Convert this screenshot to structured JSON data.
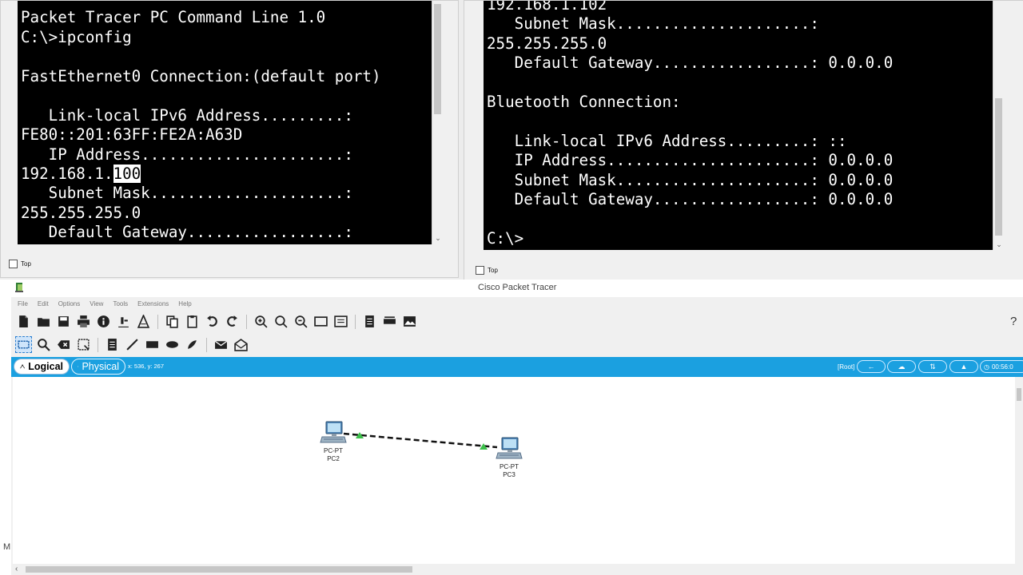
{
  "left_terminal": {
    "lines": [
      "Packet Tracer PC Command Line 1.0",
      "C:\\>ipconfig",
      "",
      "FastEthernet0 Connection:(default port)",
      "",
      "   Link-local IPv6 Address.........:",
      "FE80::201:63FF:FE2A:A63D",
      "   IP Address......................:",
      "",
      "   Subnet Mask.....................:",
      "255.255.255.0",
      "   Default Gateway.................:"
    ],
    "ip_prefix": "192.168.1.",
    "ip_selected": "100",
    "top_label": "Top"
  },
  "right_terminal": {
    "lines": [
      "192.168.1.102",
      "   Subnet Mask.....................:",
      "255.255.255.0",
      "   Default Gateway.................: 0.0.0.0",
      "",
      "Bluetooth Connection:",
      "",
      "   Link-local IPv6 Address.........: ::",
      "   IP Address......................: 0.0.0.0",
      "   Subnet Mask.....................: 0.0.0.0",
      "   Default Gateway.................: 0.0.0.0",
      "",
      "C:\\>"
    ],
    "top_label": "Top"
  },
  "packet_tracer": {
    "title": "Cisco Packet Tracer",
    "menu": [
      "File",
      "Edit",
      "Options",
      "View",
      "Tools",
      "Extensions",
      "Help"
    ],
    "help_symbol": "?",
    "tabs": {
      "logical": "Logical",
      "physical": "Physical"
    },
    "coordinates": "x: 536, y: 267",
    "root_label": "[Root]",
    "clock": "00:56:0",
    "left_edge_glyph": "M",
    "devices": [
      {
        "model": "PC-PT",
        "name": "PC2"
      },
      {
        "model": "PC-PT",
        "name": "PC3"
      }
    ],
    "link_status_color": "#3cbf4a"
  },
  "colors": {
    "terminal_bg": "#000000",
    "terminal_fg": "#ffffff",
    "toolbar_accent": "#1ba0e0"
  }
}
